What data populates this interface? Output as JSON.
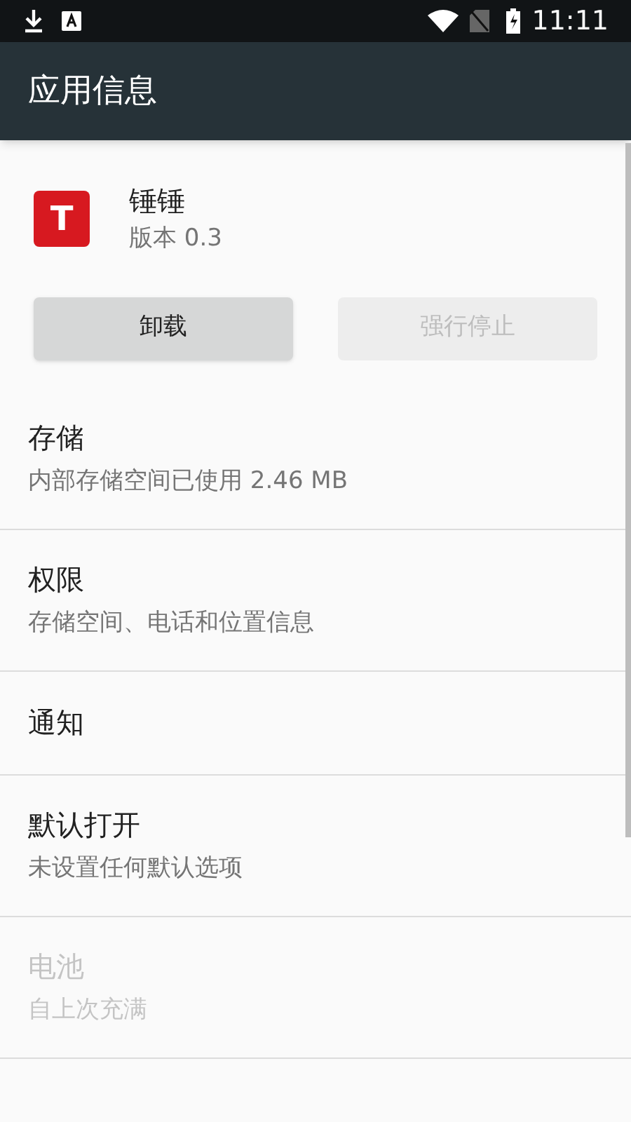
{
  "status_bar": {
    "time": "11:11"
  },
  "app_bar": {
    "title": "应用信息"
  },
  "app": {
    "name": "锤锤",
    "version": "版本 0.3",
    "icon_letter": "T"
  },
  "buttons": [
    {
      "label": "卸载",
      "disabled": false
    },
    {
      "label": "强行停止",
      "disabled": true
    }
  ],
  "sections": [
    {
      "title": "存储",
      "summary": "内部存储空间已使用 2.46 MB",
      "disabled": false
    },
    {
      "title": "权限",
      "summary": "存储空间、电话和位置信息",
      "disabled": false
    },
    {
      "title": "通知",
      "disabled": false
    },
    {
      "title": "默认打开",
      "summary": "未设置任何默认选项",
      "disabled": false
    },
    {
      "title": "电池",
      "summary": "自上次充满",
      "disabled": true
    }
  ]
}
